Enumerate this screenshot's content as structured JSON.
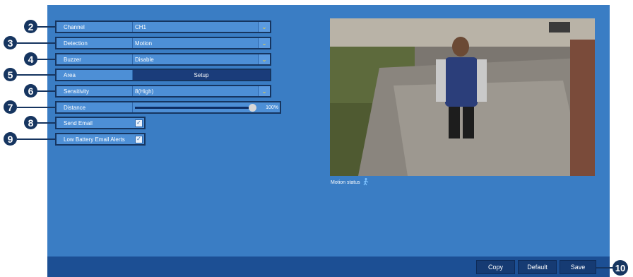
{
  "form": {
    "channel": {
      "label": "Channel",
      "value": "CH1"
    },
    "detection": {
      "label": "Detection",
      "value": "Motion"
    },
    "buzzer": {
      "label": "Buzzer",
      "value": "Disable"
    },
    "area": {
      "label": "Area",
      "button": "Setup"
    },
    "sensitivity": {
      "label": "Sensitivity",
      "value": "8(High)"
    },
    "distance": {
      "label": "Distance",
      "value": "100%",
      "level": 1.0
    },
    "send_email": {
      "label": "Send Email",
      "checked": true
    },
    "low_battery": {
      "label": "Low Battery Email Alerts",
      "checked": true
    }
  },
  "preview": {
    "motion_status_label": "Motion status"
  },
  "footer": {
    "copy": "Copy",
    "default": "Default",
    "save": "Save"
  },
  "callouts": {
    "c2": "2",
    "c3": "3",
    "c4": "4",
    "c5": "5",
    "c6": "6",
    "c7": "7",
    "c8": "8",
    "c9": "9",
    "c10": "10"
  },
  "colors": {
    "panel": "#3a7dc4",
    "field": "#4d8fd6",
    "footer": "#1c4f94",
    "callout": "#163560",
    "dropdown_arrow": "#f4d23a"
  },
  "icons": {
    "dropdown": "chevron-down-icon",
    "checkbox": "check-icon",
    "motion": "walking-person-icon"
  }
}
